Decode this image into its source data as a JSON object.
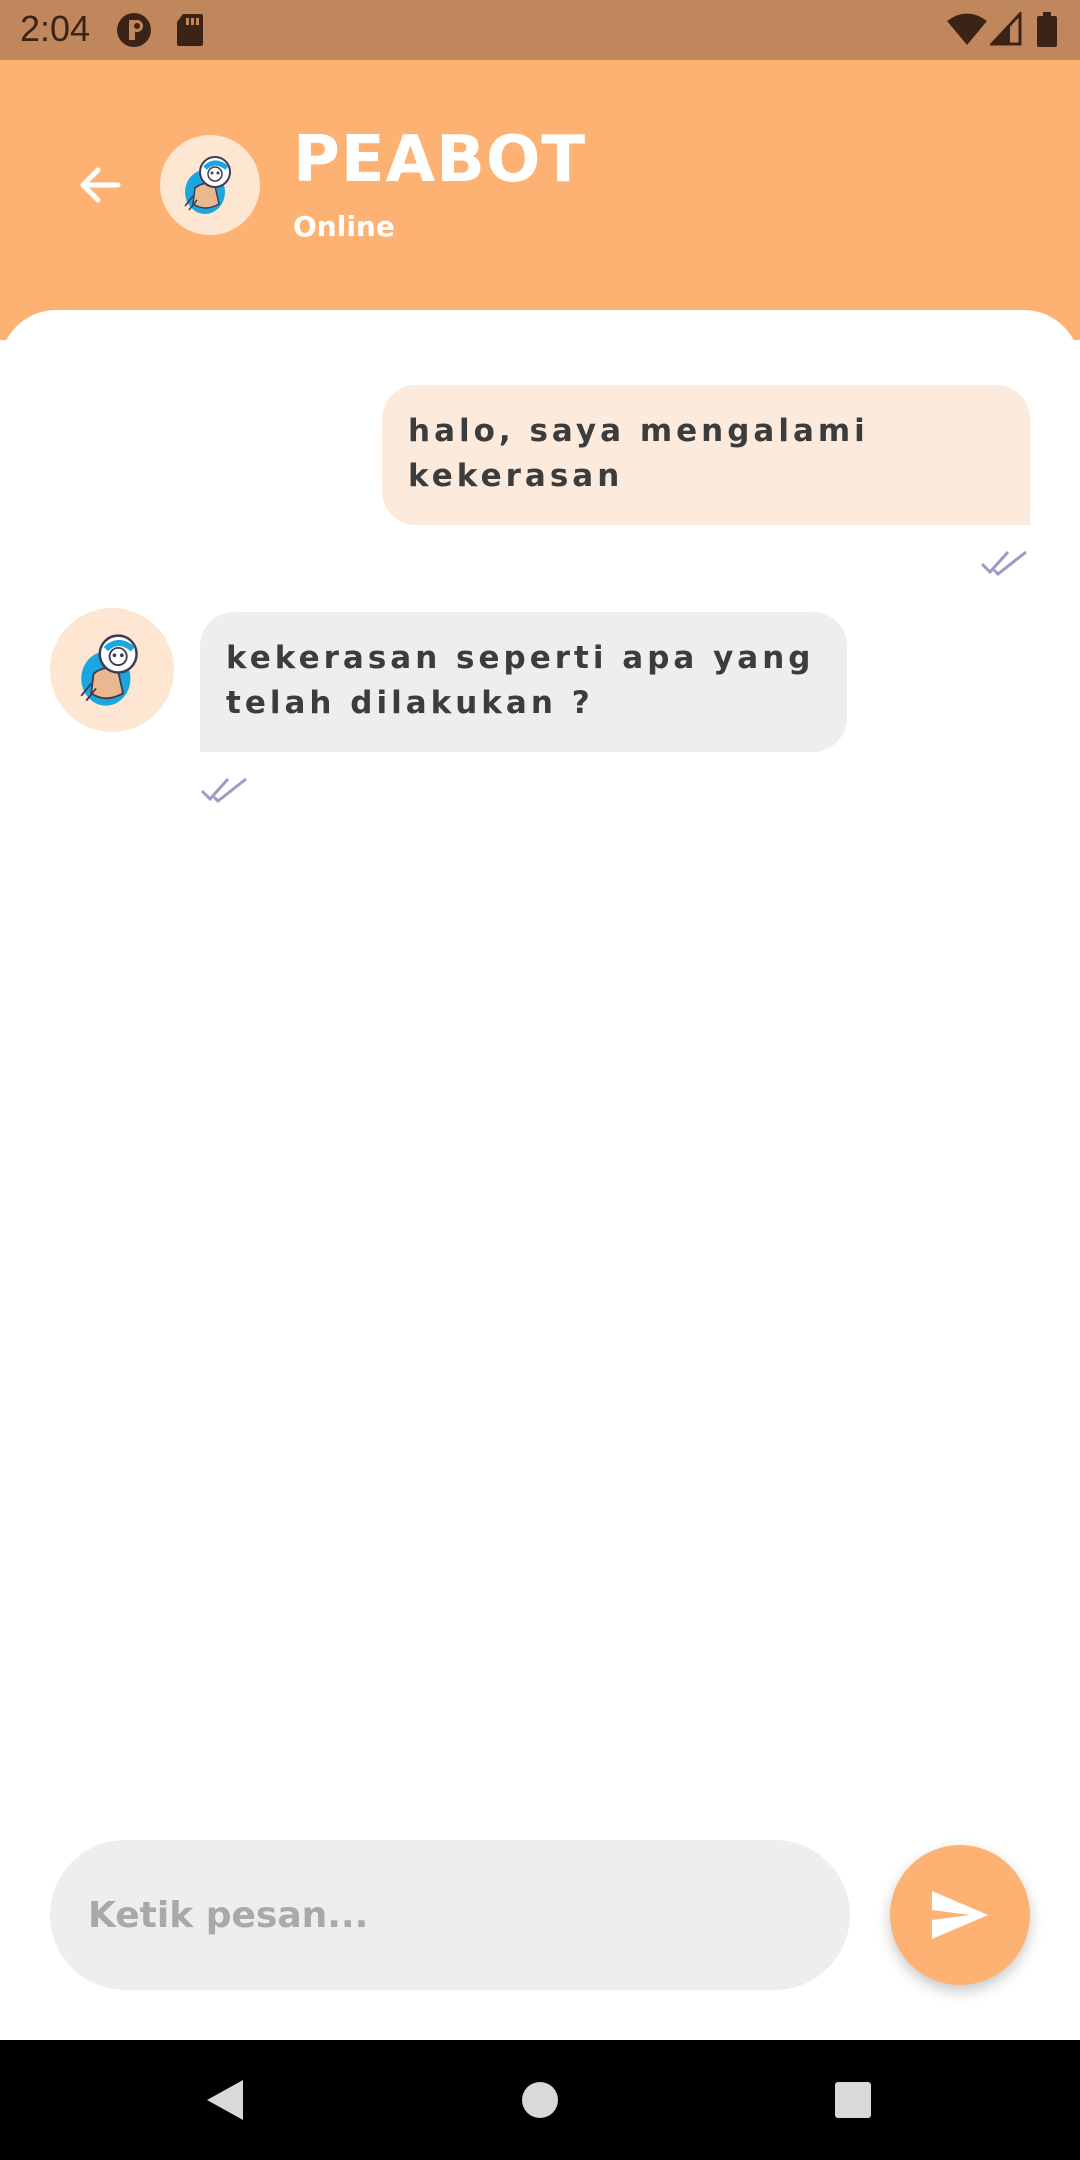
{
  "status_bar": {
    "time": "2:04",
    "icons": [
      "app-badge-icon",
      "sd-card-icon",
      "wifi-icon",
      "cell-signal-icon",
      "battery-icon"
    ]
  },
  "header": {
    "back_icon": "arrow-left-icon",
    "bot_name": "PEABOT",
    "status": "Online"
  },
  "messages": [
    {
      "sender": "user",
      "text": "halo, saya mengalami kekerasan",
      "status_icon": "double-check-icon"
    },
    {
      "sender": "bot",
      "text": "kekerasan seperti apa yang telah dilakukan ?",
      "status_icon": "double-check-icon"
    }
  ],
  "composer": {
    "placeholder": "Ketik pesan...",
    "send_icon": "send-icon"
  },
  "nav_bar": {
    "icons": [
      "back-triangle-icon",
      "home-circle-icon",
      "recents-square-icon"
    ]
  },
  "colors": {
    "status_bar": "#c0875c",
    "header": "#fdb274",
    "user_bubble": "#fcebdc",
    "bot_bubble": "#eeeeee",
    "tick": "#9d9bc2"
  }
}
